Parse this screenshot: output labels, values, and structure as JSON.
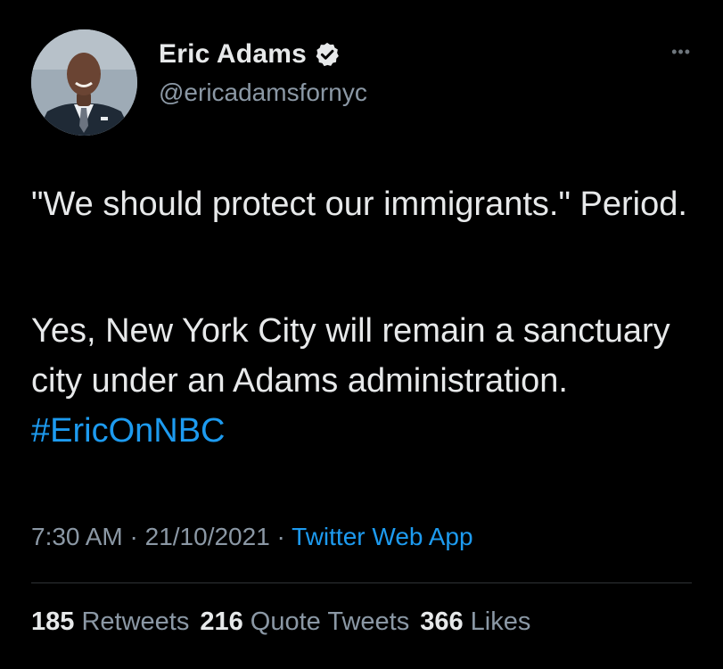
{
  "author": {
    "name": "Eric Adams",
    "handle": "@ericadamsfornyc",
    "verified": true,
    "avatar_icon": "profile-photo"
  },
  "menu_icon": "more-horizontal-icon",
  "tweet": {
    "paragraph1": "\"We should protect our immigrants.\" Period.",
    "paragraph2_text": "Yes, New York City will remain a sanctuary city under an Adams administration.",
    "hashtag": "#EricOnNBC"
  },
  "meta": {
    "time": "7:30 AM",
    "separator": "·",
    "date": "21/10/2021",
    "source": "Twitter Web App"
  },
  "stats": {
    "retweets_count": "185",
    "retweets_label": "Retweets",
    "quotes_count": "216",
    "quotes_label": "Quote Tweets",
    "likes_count": "366",
    "likes_label": "Likes"
  },
  "colors": {
    "background": "#000000",
    "text": "#e7e9ea",
    "secondary": "#8b98a5",
    "accent": "#1d9bf0",
    "divider": "#2f3336"
  }
}
